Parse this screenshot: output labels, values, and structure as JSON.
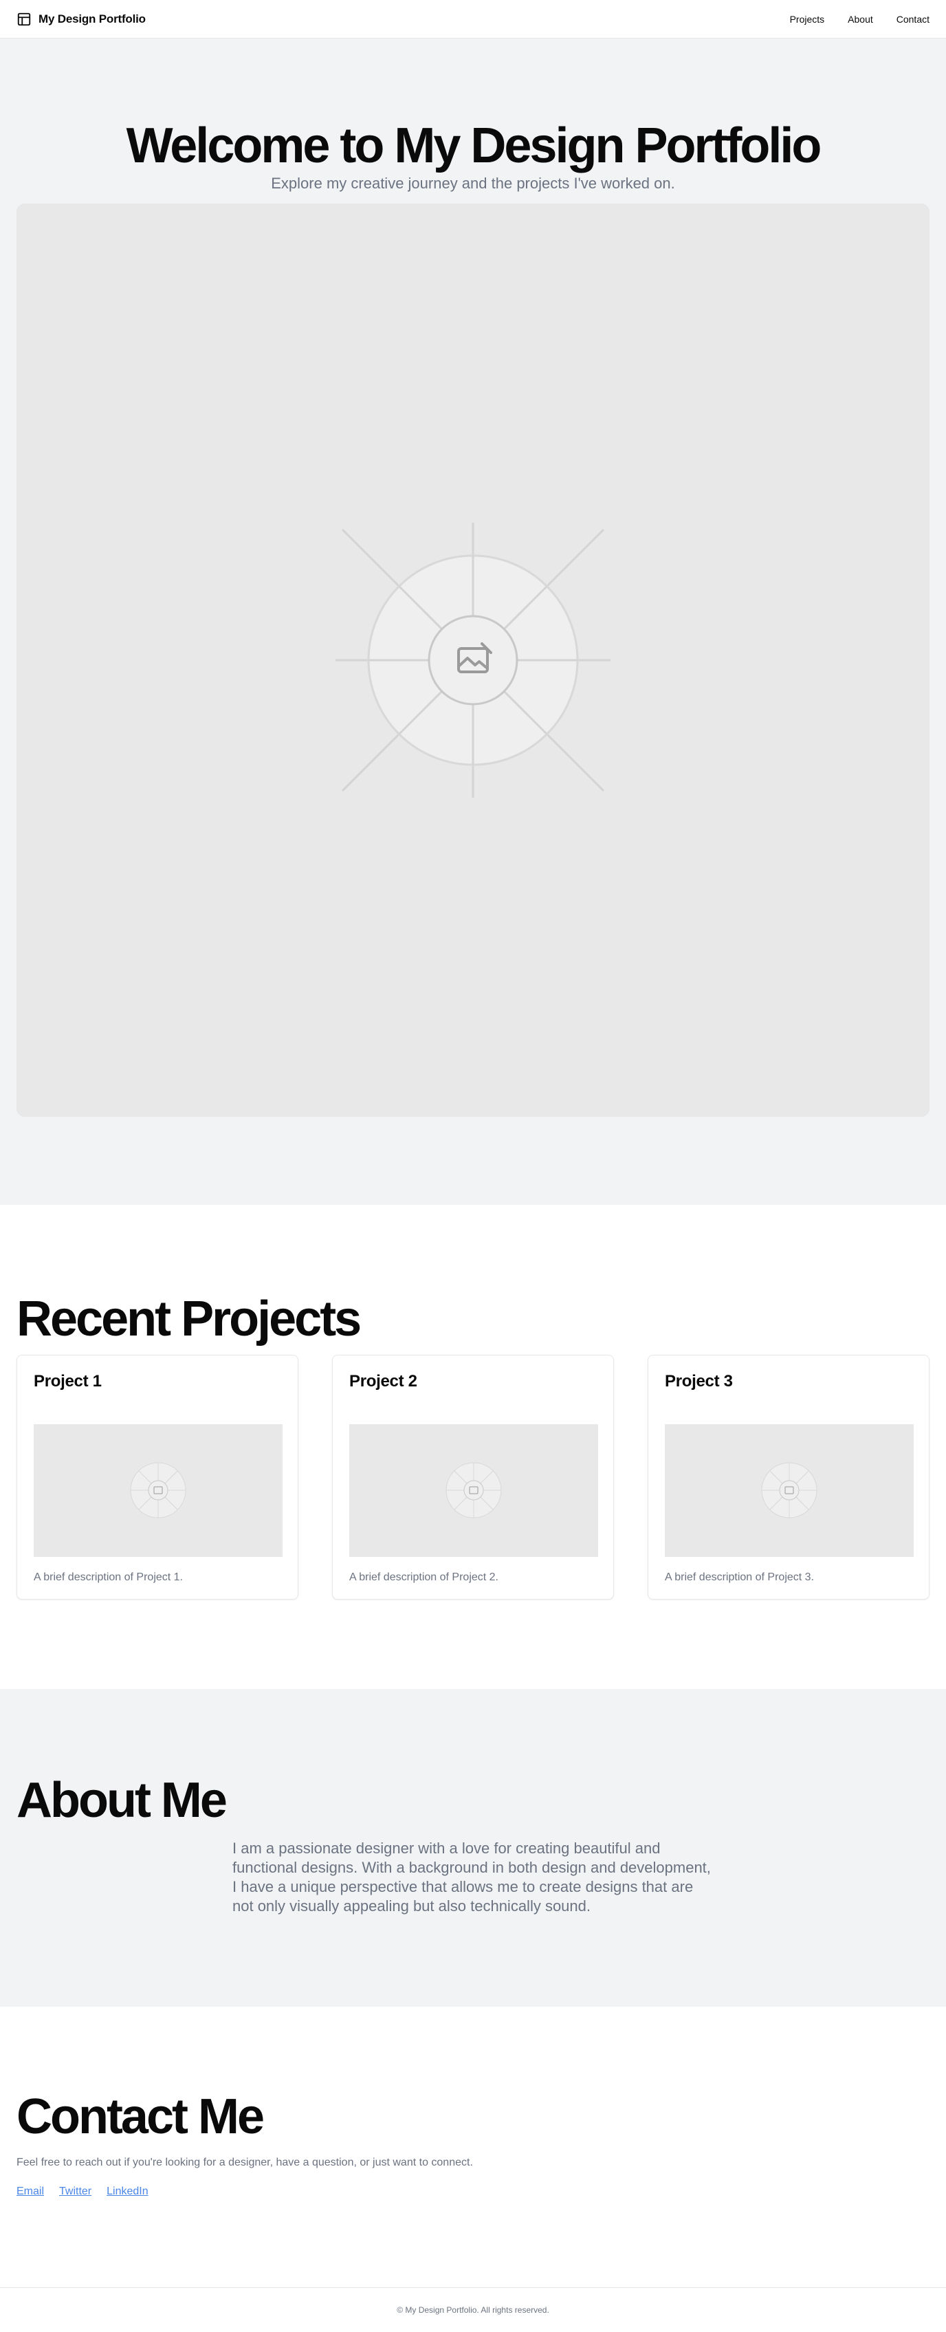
{
  "header": {
    "brand_icon": "layout-icon",
    "brand_name": "My Design Portfolio",
    "nav": [
      {
        "label": "Projects"
      },
      {
        "label": "About"
      },
      {
        "label": "Contact"
      }
    ]
  },
  "hero": {
    "title": "Welcome to My Design Portfolio",
    "subtitle": "Explore my creative journey and the projects I've worked on.",
    "image_icon": "image-placeholder-icon"
  },
  "projects": {
    "title": "Recent Projects",
    "items": [
      {
        "title": "Project 1",
        "description": "A brief description of Project 1."
      },
      {
        "title": "Project 2",
        "description": "A brief description of Project 2."
      },
      {
        "title": "Project 3",
        "description": "A brief description of Project 3."
      }
    ]
  },
  "about": {
    "title": "About Me",
    "text": "I am a passionate designer with a love for creating beautiful and functional designs. With a background in both design and development, I have a unique perspective that allows me to create designs that are not only visually appealing but also technically sound."
  },
  "contact": {
    "title": "Contact Me",
    "text": "Feel free to reach out if you're looking for a designer, have a question, or just want to connect.",
    "links": [
      {
        "label": "Email"
      },
      {
        "label": "Twitter"
      },
      {
        "label": "LinkedIn"
      }
    ]
  },
  "footer": {
    "text": "© My Design Portfolio. All rights reserved."
  },
  "colors": {
    "section_bg": "#f1f3f5",
    "muted_text": "#6b7280",
    "link": "#4a86e8",
    "placeholder_bg": "#e8e8e8"
  }
}
